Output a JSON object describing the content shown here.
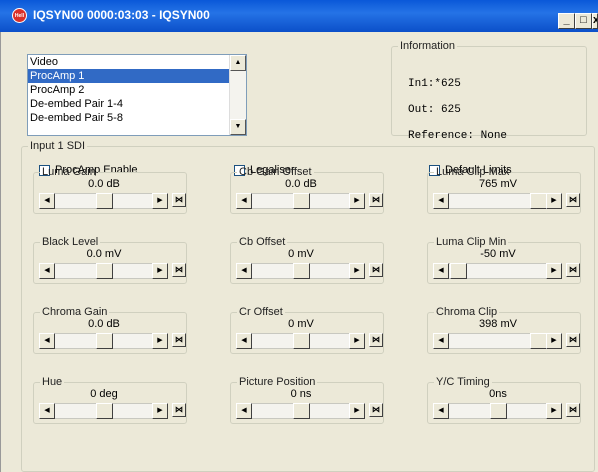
{
  "window": {
    "title": "IQSYN00 0000:03:03 - IQSYN00",
    "icon_label": "Hell Dish",
    "buttons": {
      "minimize": "_",
      "maximize": "□",
      "close": "x"
    }
  },
  "module_list": {
    "items": [
      "Video",
      "ProcAmp 1",
      "ProcAmp 2",
      "De-embed Pair 1-4",
      "De-embed Pair 5-8"
    ],
    "selected": "ProcAmp 1"
  },
  "information": {
    "legend": "Information",
    "in1": "In1:*625",
    "out": "Out: 625",
    "reference": "Reference: None"
  },
  "input_group": {
    "legend": "Input 1 SDI",
    "checks": {
      "procamp_enable": "ProcAmp Enable",
      "legaliser": "Legaliser",
      "default_limits": "Default Limits"
    }
  },
  "controls": {
    "luma_gain": {
      "label": "Luma Gain",
      "value": "0.0 dB",
      "position": 0.5
    },
    "black_level": {
      "label": "Black Level",
      "value": "0.0 mV",
      "position": 0.5
    },
    "chroma_gain": {
      "label": "Chroma Gain",
      "value": "0.0 dB",
      "position": 0.5
    },
    "hue": {
      "label": "Hue",
      "value": "0 deg",
      "position": 0.5
    },
    "cb_gain_offset": {
      "label": "Cb Gain Offset",
      "value": "0.0 dB",
      "position": 0.5
    },
    "cb_offset": {
      "label": "Cb Offset",
      "value": "0 mV",
      "position": 0.5
    },
    "cr_offset": {
      "label": "Cr Offset",
      "value": "0 mV",
      "position": 0.5
    },
    "picture_position": {
      "label": "Picture Position",
      "value": "0 ns",
      "position": 0.5
    },
    "luma_clip_max": {
      "label": "Luma Clip Max",
      "value": "765 mV",
      "position": 1.0
    },
    "luma_clip_min": {
      "label": "Luma Clip Min",
      "value": "-50 mV",
      "position": 0.0
    },
    "chroma_clip": {
      "label": "Chroma Clip",
      "value": "398 mV",
      "position": 1.0
    },
    "yc_timing": {
      "label": "Y/C Timing",
      "value": "0ns",
      "position": 0.5
    }
  },
  "colors": {
    "titlebar": "#0a58d8",
    "selection": "#316ac5",
    "window_bg": "#ece9d8"
  },
  "icons": {
    "scroll_left": "left-arrow-icon",
    "scroll_right": "right-arrow-icon",
    "reset": "reset-icon"
  }
}
